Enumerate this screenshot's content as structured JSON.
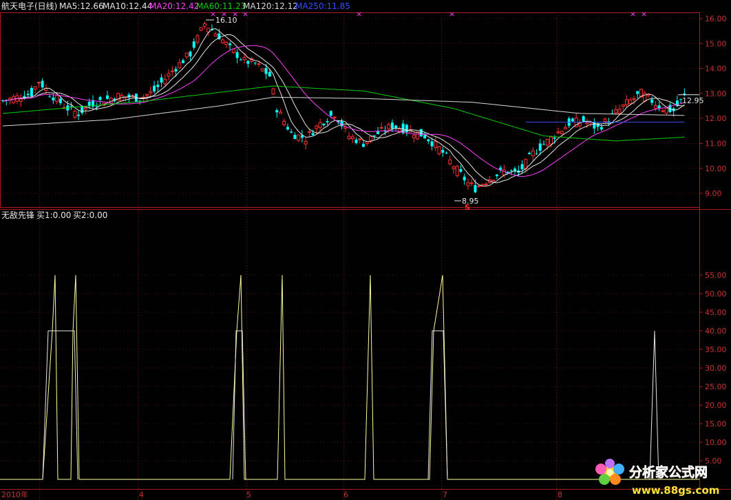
{
  "header": {
    "stock_name": "航天电子(日线)",
    "ma_items": [
      {
        "text": "MA5:12.66",
        "color": "#e8e8e8"
      },
      {
        "text": "MA10:12.44",
        "color": "#e8e8e8"
      },
      {
        "text": "MA20:12.42",
        "color": "#ff40ff"
      },
      {
        "text": "MA60:11.23",
        "color": "#00d000"
      },
      {
        "text": "MA120:12.12",
        "color": "#d8d8d8"
      },
      {
        "text": "MA250:11.85",
        "color": "#3050ff"
      }
    ]
  },
  "lower_header": {
    "title": "无敌先锋",
    "buy1": "买1:0.00",
    "buy2": "买2:0.00"
  },
  "watermark": {
    "site": "分析家公式网",
    "url": "www.88gs.com"
  },
  "chart_data": [
    {
      "type": "candlestick",
      "y_ticks": [
        "9.00",
        "10.00",
        "11.00",
        "12.00",
        "13.00",
        "14.00",
        "15.00",
        "16.00"
      ],
      "ylim": [
        8.6,
        16.3
      ],
      "annotations": {
        "high_label": "16.10",
        "low_label": "8.95",
        "last_label": "12.95",
        "signal_label": "S"
      },
      "x_labels": [
        "2010年",
        "4",
        "5",
        "6",
        "7",
        "8"
      ],
      "series": [
        {
          "name": "MA5",
          "color": "#e8e8e8"
        },
        {
          "name": "MA10",
          "color": "#e8e8e8"
        },
        {
          "name": "MA20",
          "color": "#ff40ff"
        },
        {
          "name": "MA60",
          "color": "#00d000"
        },
        {
          "name": "MA120",
          "color": "#d8d8d8"
        },
        {
          "name": "MA250",
          "color": "#3050ff"
        }
      ]
    },
    {
      "type": "line",
      "title": "无敌先锋",
      "y_ticks": [
        "5.00",
        "10.00",
        "15.00",
        "20.00",
        "25.00",
        "30.00",
        "35.00",
        "40.00",
        "45.00",
        "50.00",
        "55.00"
      ],
      "ylim": [
        0,
        57
      ],
      "series": [
        {
          "name": "买1",
          "color": "#ffffa0",
          "peaks": [
            55,
            55,
            55,
            55,
            55,
            55
          ]
        },
        {
          "name": "买2",
          "color": "#e8e8e8",
          "peaks": [
            40,
            40,
            40,
            40
          ]
        }
      ]
    }
  ],
  "colors": {
    "up": "#ff3030",
    "down": "#00ffff",
    "axis": "#b01818",
    "tick_text": "#c83232"
  }
}
